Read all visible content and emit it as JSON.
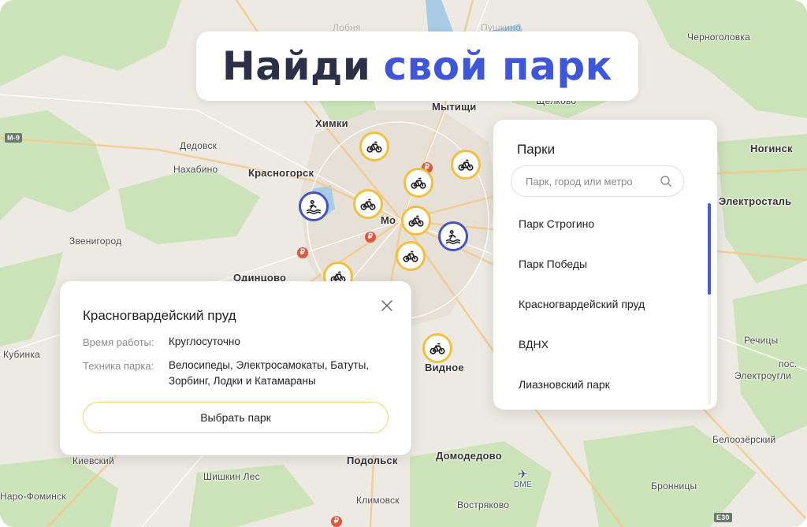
{
  "title": {
    "part1": "Найди",
    "part2": "свой парк"
  },
  "colors": {
    "accent_blue": "#3e56d9",
    "title_dark": "#2b2f48",
    "marker_yellow": "#f2c03c",
    "marker_blue": "#4053c8"
  },
  "map": {
    "labels": [
      "Черноголовка",
      "Химки",
      "Мытищи",
      "Щёлково",
      "Дедовск",
      "Нахабино",
      "Красногорск",
      "Ногинск",
      "Звенигород",
      "Электросталь",
      "Одинцово",
      "Кубинка",
      "Видное",
      "Речицы",
      "пос.",
      "Электроугли",
      "Белоозёрский",
      "Киевский",
      "Подольск",
      "Домодедово",
      "Бронницы",
      "Шишкин Лес",
      "Наро-Фоминск",
      "Климовск",
      "Востряково",
      "Мо",
      "Лобня",
      "Пушкино"
    ],
    "road_labels": [
      "М-9",
      "Е30"
    ],
    "airport": "DME",
    "markers": [
      {
        "type": "bike",
        "icon": "bicycle-icon"
      },
      {
        "type": "bike",
        "icon": "bicycle-icon"
      },
      {
        "type": "bike",
        "icon": "bicycle-icon"
      },
      {
        "type": "bike",
        "icon": "bicycle-icon"
      },
      {
        "type": "bike",
        "icon": "bicycle-icon"
      },
      {
        "type": "bike",
        "icon": "bicycle-icon"
      },
      {
        "type": "bike",
        "icon": "bicycle-icon"
      },
      {
        "type": "bike",
        "icon": "bicycle-icon"
      },
      {
        "type": "water",
        "icon": "water-activity-icon"
      },
      {
        "type": "water",
        "icon": "water-activity-icon"
      }
    ]
  },
  "parks_panel": {
    "title": "Парки",
    "search_placeholder": "Парк, город или метро",
    "search_icon": "search-icon",
    "items": [
      "Парк Строгино",
      "Парк Победы",
      "Красногвардейский пруд",
      "ВДНХ",
      "Лиазновский парк"
    ]
  },
  "info_card": {
    "title": "Красногвардейский пруд",
    "hours_label": "Время работы:",
    "hours_value": "Круглосуточно",
    "equipment_label": "Техника парка:",
    "equipment_value": "Велосипеды, Электросамокаты, Батуты, Зорбинг, Лодки и Катамараны",
    "button_label": "Выбрать парк",
    "close_icon": "close-icon"
  }
}
